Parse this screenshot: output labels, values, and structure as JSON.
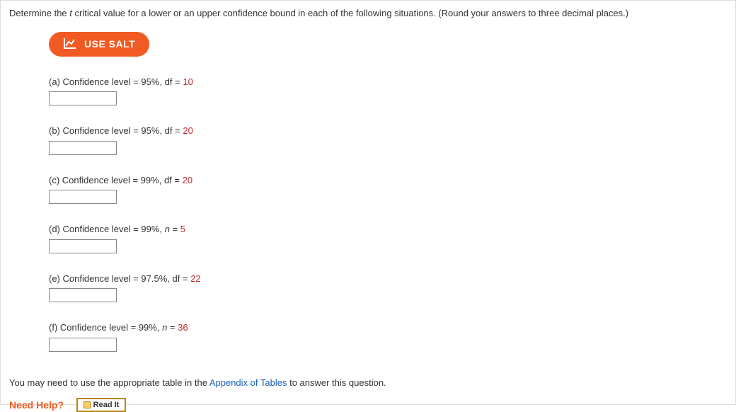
{
  "prompt": {
    "prefix": "Determine the ",
    "italic": "t",
    "suffix": " critical value for a lower or an upper confidence bound in each of the following situations. (Round your answers to three decimal places.)"
  },
  "salt_button": "USE SALT",
  "parts": {
    "a": {
      "label": "(a) Confidence level = 95%, df = ",
      "value": "10"
    },
    "b": {
      "label": "(b) Confidence level = 95%, df = ",
      "value": "20"
    },
    "c": {
      "label": "(c) Confidence level = 99%, df = ",
      "value": "20"
    },
    "d": {
      "label": "(d) Confidence level = 99%, ",
      "param": "n",
      "eq": " = ",
      "value": "5"
    },
    "e": {
      "label": "(e) Confidence level = 97.5%, df = ",
      "value": "22"
    },
    "f": {
      "label": "(f) Confidence level = 99%, ",
      "param": "n",
      "eq": " = ",
      "value": "36"
    }
  },
  "appendix": {
    "prefix": "You may need to use the appropriate table in the ",
    "link": "Appendix of Tables",
    "suffix": " to answer this question."
  },
  "help": {
    "label": "Need Help?",
    "read_it": "Read It"
  }
}
